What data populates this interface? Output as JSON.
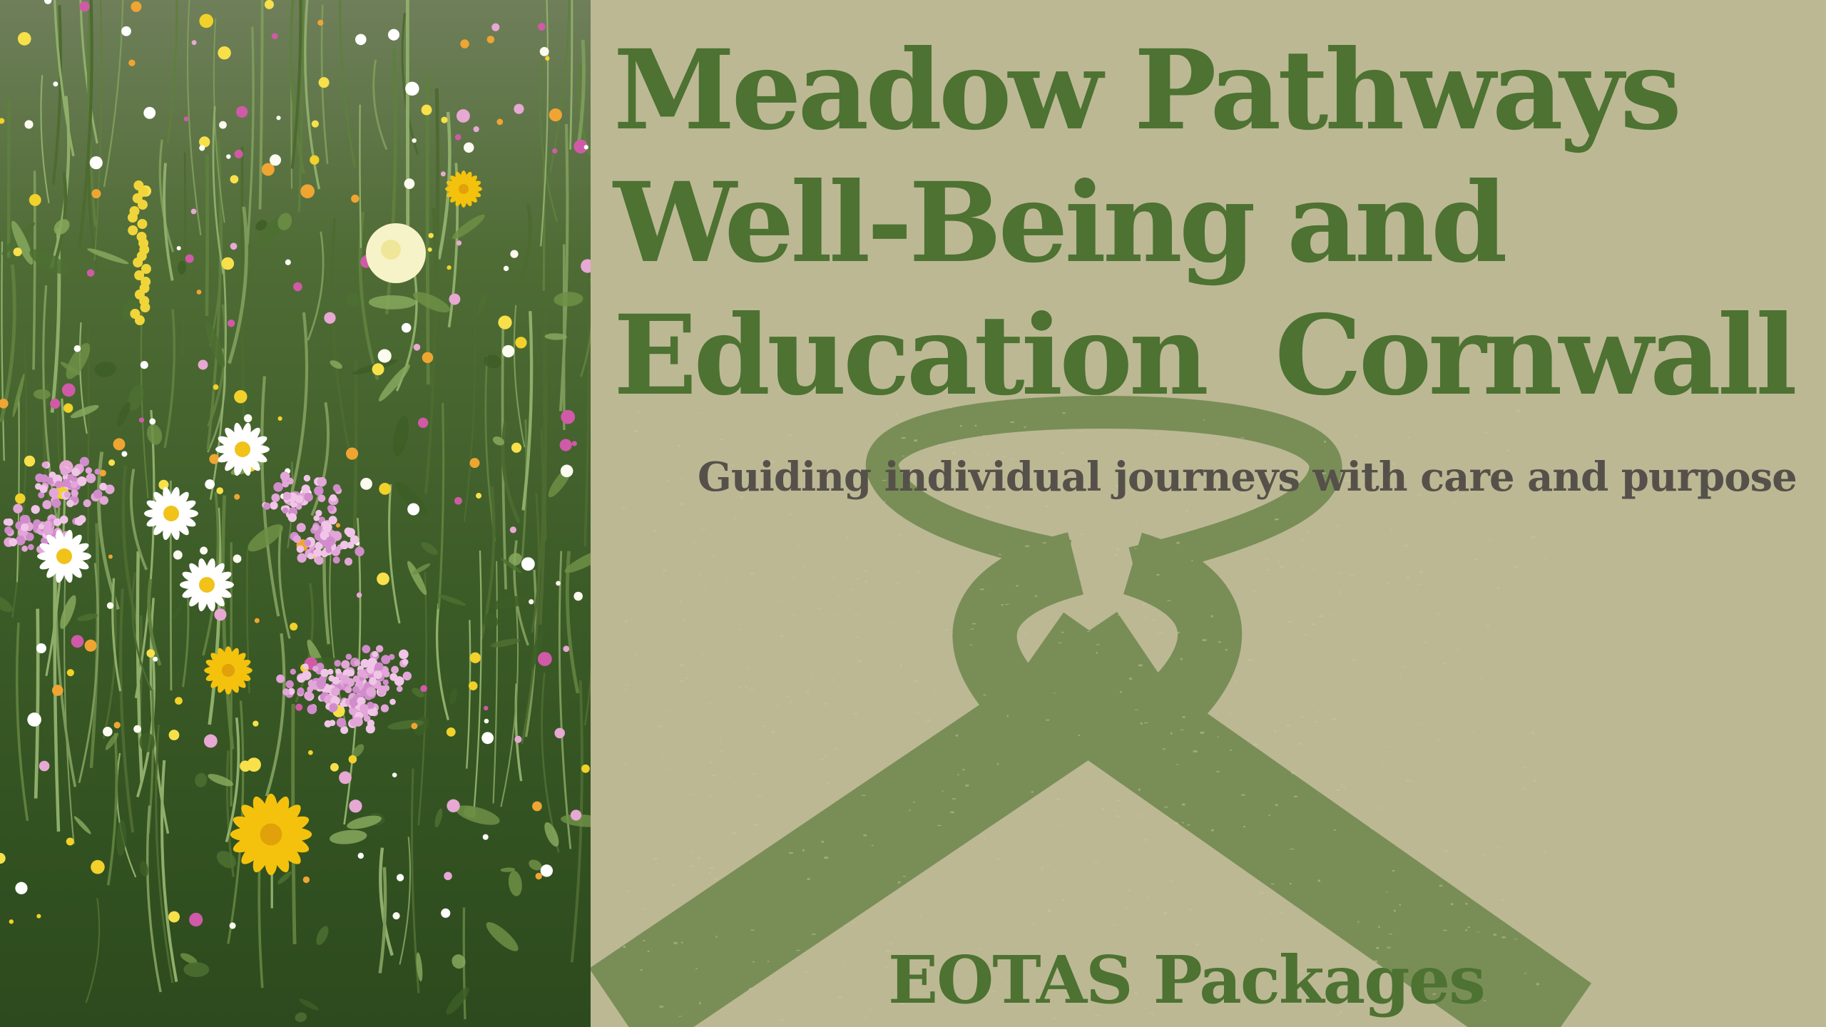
{
  "hero": {
    "title_lines": [
      "Meadow Pathways",
      "Well-Being and",
      "Education  Cornwall"
    ],
    "tagline": "Guiding individual journeys with care and purpose",
    "footer": "EOTAS Packages"
  },
  "colors": {
    "background": "#bcb894",
    "title": "#4d7232",
    "tagline": "#55514a",
    "ribbon": "#5f7e3f"
  },
  "icons": {
    "ribbon": "awareness-ribbon-icon",
    "photo": "wildflower-meadow-photo"
  }
}
